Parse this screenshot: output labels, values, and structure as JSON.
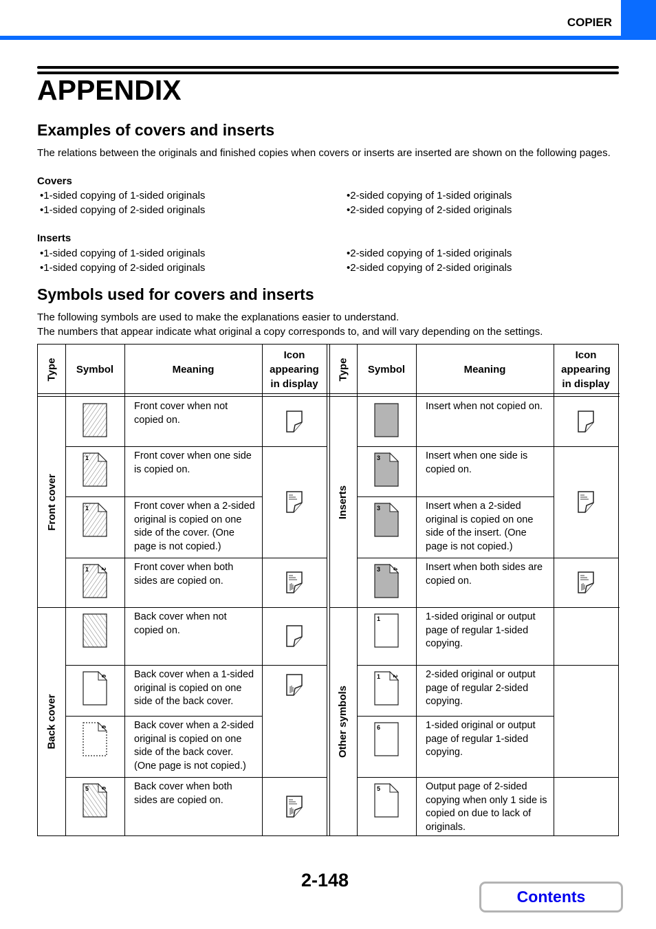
{
  "header": {
    "section": "COPIER",
    "accent_color": "#0a6cff"
  },
  "page_title": "APPENDIX",
  "examples": {
    "heading": "Examples of covers and inserts",
    "intro": "The relations between the originals and finished copies when covers or inserts are inserted are shown on the following pages.",
    "covers": {
      "label": "Covers",
      "left": [
        "1-sided copying of 1-sided originals",
        "1-sided copying of 2-sided originals"
      ],
      "right": [
        "2-sided copying of 1-sided originals",
        "2-sided copying of 2-sided originals"
      ]
    },
    "inserts": {
      "label": "Inserts",
      "left": [
        "1-sided copying of 1-sided originals",
        "1-sided copying of 2-sided originals"
      ],
      "right": [
        "2-sided copying of 1-sided originals",
        "2-sided copying of 2-sided originals"
      ]
    }
  },
  "symbols": {
    "heading": "Symbols used for covers and inserts",
    "line1": "The following symbols are used to make the explanations easier to understand.",
    "line2": "The numbers that appear indicate what original a copy corresponds to, and will vary depending on the settings.",
    "table": {
      "headers": {
        "type": "Type",
        "symbol": "Symbol",
        "meaning": "Meaning",
        "icon": "Icon appearing in display"
      },
      "groups": {
        "front_cover": "Front cover",
        "back_cover": "Back cover",
        "inserts": "Inserts",
        "other": "Other symbols"
      },
      "left_rows": [
        {
          "symbol": "hatched-blank-sheet-icon",
          "numbers": [],
          "meaning": "Front cover when not copied on.",
          "display_icon": "blank-page-display-icon"
        },
        {
          "symbol": "hatched-sheet-one-side-icon",
          "numbers": [
            "1"
          ],
          "meaning": "Front cover when one side is copied on.",
          "display_icon": "one-side-printed-display-icon"
        },
        {
          "symbol": "hatched-sheet-2sided-one-side-icon",
          "numbers": [
            "1"
          ],
          "meaning": "Front cover when a 2-sided original is copied on one side of the cover. (One page is not copied.)",
          "display_icon": "one-side-printed-display-icon"
        },
        {
          "symbol": "hatched-sheet-both-sides-icon",
          "numbers": [
            "1",
            "2"
          ],
          "meaning": "Front cover when both sides are copied on.",
          "display_icon": "both-sides-printed-display-icon"
        },
        {
          "symbol": "hatched-back-blank-sheet-icon",
          "numbers": [],
          "meaning": "Back cover when not copied on.",
          "display_icon": "blank-page-display-icon"
        },
        {
          "symbol": "back-sheet-one-side-icon",
          "numbers": [
            "6"
          ],
          "meaning": "Back cover when a 1-sided original is copied on one side of the back cover.",
          "display_icon": "back-side-printed-display-icon"
        },
        {
          "symbol": "back-sheet-2sided-one-side-icon",
          "numbers": [
            "6"
          ],
          "meaning": "Back cover when a 2-sided original is copied on one side of the back cover. (One page is not copied.)",
          "display_icon": "back-side-printed-display-icon"
        },
        {
          "symbol": "hatched-back-sheet-both-sides-icon",
          "numbers": [
            "5",
            "6"
          ],
          "meaning": "Back cover when both sides are copied on.",
          "display_icon": "both-sides-printed-display-icon"
        }
      ],
      "right_rows": [
        {
          "symbol": "gray-blank-sheet-icon",
          "numbers": [],
          "meaning": "Insert when not copied on.",
          "display_icon": "blank-page-display-icon"
        },
        {
          "symbol": "gray-sheet-one-side-icon",
          "numbers": [
            "3"
          ],
          "meaning": "Insert when one side is copied on.",
          "display_icon": "one-side-printed-display-icon"
        },
        {
          "symbol": "gray-sheet-2sided-one-side-icon",
          "numbers": [
            "3"
          ],
          "meaning": "Insert when a 2-sided original is copied on one side of the insert. (One page is not copied.)",
          "display_icon": "one-side-printed-display-icon"
        },
        {
          "symbol": "gray-sheet-both-sides-icon",
          "numbers": [
            "3",
            "4"
          ],
          "meaning": "Insert when both sides are copied on.",
          "display_icon": "both-sides-printed-display-icon"
        },
        {
          "symbol": "plain-sheet-icon",
          "numbers": [
            "1"
          ],
          "meaning": "1-sided original or output page of regular 1-sided copying.",
          "display_icon": ""
        },
        {
          "symbol": "plain-sheet-2sided-icon",
          "numbers": [
            "1",
            "2"
          ],
          "meaning": "2-sided original or output page of regular 2-sided copying.",
          "display_icon": ""
        },
        {
          "symbol": "plain-sheet-icon",
          "numbers": [
            "6"
          ],
          "meaning": "1-sided original or output page of regular 1-sided copying.",
          "display_icon": ""
        },
        {
          "symbol": "plain-sheet-folded-icon",
          "numbers": [
            "5"
          ],
          "meaning": "Output page of 2-sided copying when only 1 side is copied on due to lack of originals.",
          "display_icon": ""
        }
      ]
    }
  },
  "footer": {
    "page_number": "2-148",
    "contents_label": "Contents",
    "contents_color": "#0000ee"
  }
}
